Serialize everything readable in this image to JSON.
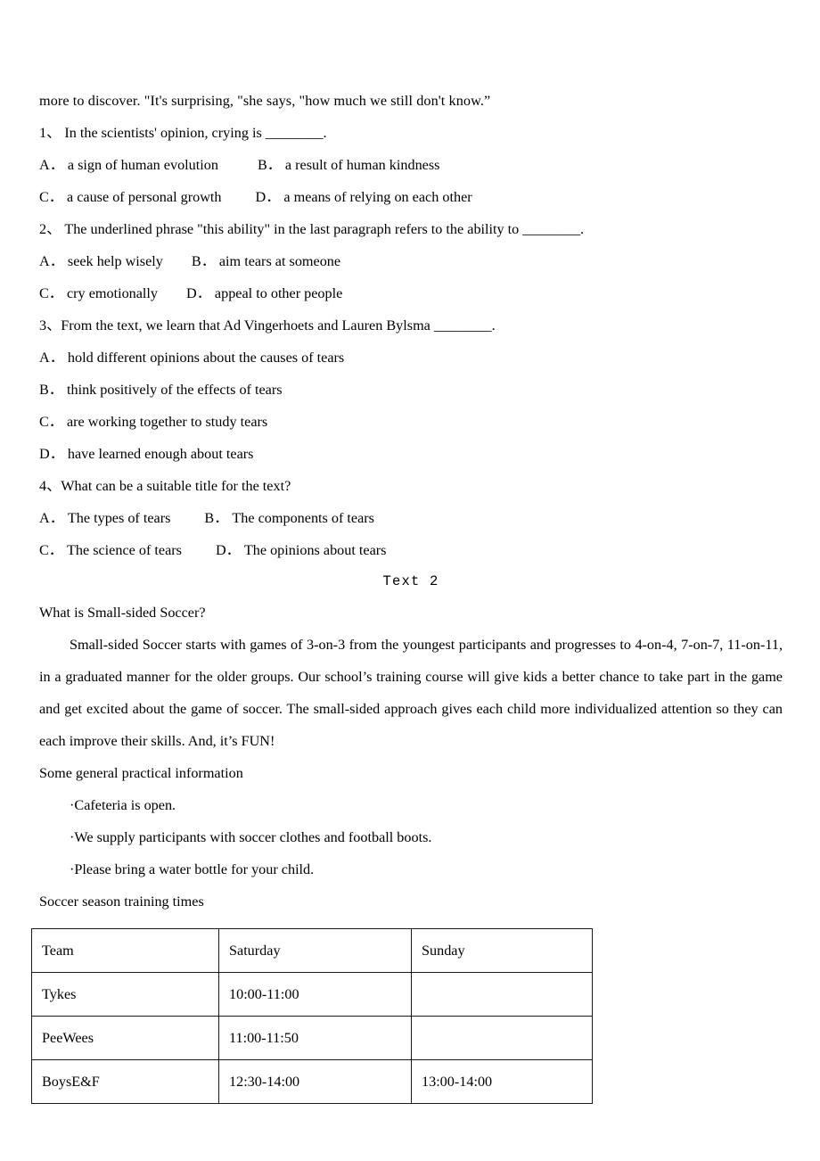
{
  "document": {
    "continued_text": "more to discover. \"It's surprising, \"she says, \"how much we still don't know.”",
    "questions": [
      {
        "number": "1、",
        "stem": "In the scientists' opinion, crying is ________.",
        "options": [
          {
            "label": "A．",
            "text": "a sign of human evolution"
          },
          {
            "label": "B．",
            "text": "a result of human kindness"
          },
          {
            "label": "C．",
            "text": "a cause of personal growth"
          },
          {
            "label": "D．",
            "text": "a means of relying on each other"
          }
        ]
      },
      {
        "number": "2、",
        "stem": "The underlined phrase \"this ability\" in the last paragraph refers to the ability to ________.",
        "options": [
          {
            "label": "A．",
            "text": "seek help wisely"
          },
          {
            "label": "B．",
            "text": "aim tears at someone"
          },
          {
            "label": "C．",
            "text": "cry emotionally"
          },
          {
            "label": "D．",
            "text": "appeal to other people"
          }
        ]
      },
      {
        "number": "3、",
        "stem": "From the text, we learn that Ad Vingerhoets and Lauren Bylsma ________.",
        "options": [
          {
            "label": "A．",
            "text": "hold different opinions about the causes of tears"
          },
          {
            "label": "B．",
            "text": "think positively of the effects of tears"
          },
          {
            "label": "C．",
            "text": "are working together to study tears"
          },
          {
            "label": "D．",
            "text": "have learned enough about tears"
          }
        ]
      },
      {
        "number": "4、",
        "stem": "What can be a suitable title for the text?",
        "options": [
          {
            "label": "A．",
            "text": "The types of tears"
          },
          {
            "label": "B．",
            "text": "The components of tears"
          },
          {
            "label": "C．",
            "text": "The science of tears"
          },
          {
            "label": "D．",
            "text": "The opinions about tears"
          }
        ]
      }
    ],
    "text2": {
      "section_title": "Text 2",
      "heading": "What is Small-sided Soccer?",
      "paragraph": "Small-sided Soccer starts with games of 3-on-3 from the youngest participants and progresses to 4-on-4, 7-on-7, 11-on-11, in a graduated manner for the older groups. Our school’s training course will give kids a better chance to take part in the game and get excited about the game of soccer. The small-sided approach gives each child more individualized attention so they can each improve their skills. And, it’s FUN!",
      "info_heading": "Some general practical information",
      "bullets": [
        "·Cafeteria is open.",
        "·We supply participants with soccer clothes and football boots.",
        "·Please bring a water bottle for your child."
      ],
      "table_caption": "Soccer season training times",
      "table": {
        "headers": [
          "Team",
          "Saturday",
          "Sunday"
        ],
        "rows": [
          [
            "Tykes",
            "10:00-11:00",
            ""
          ],
          [
            "PeeWees",
            "11:00-11:50",
            ""
          ],
          [
            "BoysE&F",
            "12:30-14:00",
            "13:00-14:00"
          ]
        ]
      }
    }
  }
}
